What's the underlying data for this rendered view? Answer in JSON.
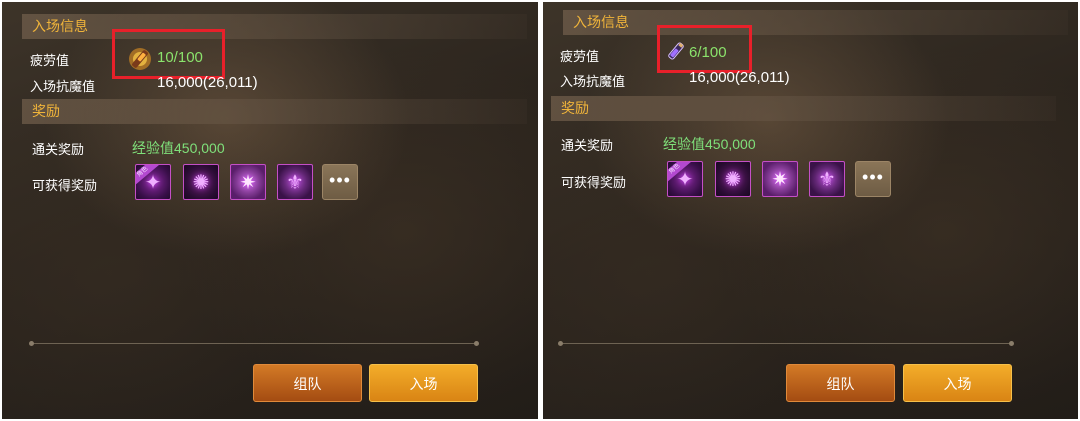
{
  "colors": {
    "section_title": "#f0b43a",
    "fatigue_green": "#8be36c",
    "reward_green": "#7fe07a",
    "highlight_red": "#e8202a",
    "team_button": "#c0621c",
    "enter_button": "#eb9d22"
  },
  "panels": [
    {
      "entry_info_title": "入场信息",
      "fatigue_label": "疲劳值",
      "fatigue_icon": "flame-potion-icon",
      "fatigue_value": "10/100",
      "resist_label": "入场抗魔值",
      "resist_value": "16,000(26,011)",
      "reward_title": "奖励",
      "clear_reward_label": "通关奖励",
      "clear_reward_value": "经验值450,000",
      "obtainable_label": "可获得奖励",
      "reward_items": [
        "character-crystal-icon",
        "purple-orb-icon",
        "pink-star-icon",
        "crest-shield-icon"
      ],
      "reward_badge": "角色",
      "more_label": "•••",
      "team_button": "组队",
      "enter_button": "入场"
    },
    {
      "entry_info_title": "入场信息",
      "fatigue_label": "疲劳值",
      "fatigue_icon": "vial-potion-icon",
      "fatigue_value": "6/100",
      "resist_label": "入场抗魔值",
      "resist_value": "16,000(26,011)",
      "reward_title": "奖励",
      "clear_reward_label": "通关奖励",
      "clear_reward_value": "经验值450,000",
      "obtainable_label": "可获得奖励",
      "reward_items": [
        "character-crystal-icon",
        "purple-orb-icon",
        "pink-star-icon",
        "crest-shield-icon"
      ],
      "reward_badge": "角色",
      "more_label": "•••",
      "team_button": "组队",
      "enter_button": "入场"
    }
  ]
}
